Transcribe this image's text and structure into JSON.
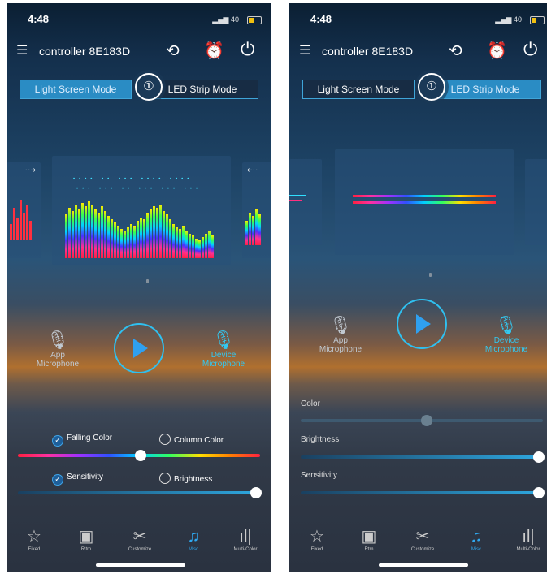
{
  "screens": [
    {
      "status": {
        "time": "4:48",
        "signal": "40"
      },
      "header": {
        "title": "controller 8E183D"
      },
      "modes": {
        "light": "Light Screen Mode",
        "led": "LED Strip Mode",
        "active": "light"
      },
      "mics": {
        "app": "App Microphone",
        "device": "Device Microphone"
      },
      "options": {
        "falling": "Falling Color",
        "column": "Column Color",
        "sensitivity": "Sensitivity",
        "brightness": "Brightness"
      },
      "sliders": {
        "color_level": 0.5,
        "sensitivity_level": 0.98
      },
      "tabs": [
        "Fixed",
        "Ritm",
        "Customize",
        "Misc",
        "Multi-Color"
      ]
    },
    {
      "status": {
        "time": "4:48",
        "signal": "40"
      },
      "header": {
        "title": "controller 8E183D"
      },
      "modes": {
        "light": "Light Screen Mode",
        "led": "LED Strip Mode",
        "active": "led"
      },
      "mics": {
        "app": "App Microphone",
        "device": "Device Microphone"
      },
      "sliders": {
        "color_label": "Color",
        "brightness_label": "Brightness",
        "sensitivity_label": "Sensitivity",
        "color_level": 0.5,
        "brightness_level": 1.0,
        "sensitivity_level": 1.0
      },
      "tabs": [
        "Fixed",
        "Rtm",
        "Customize",
        "Misc",
        "Multi-Color"
      ]
    }
  ],
  "colors": {
    "accent": "#2fa8f0",
    "mode_active": "#2a8cc4",
    "mode_border": "#3fa5d8"
  },
  "icons": [
    "menu-icon",
    "timer-icon",
    "alarm-icon",
    "power-icon",
    "microphone-icon",
    "play-icon",
    "pin-icon",
    "save-icon",
    "tools-icon",
    "music-icon",
    "bars-icon"
  ]
}
